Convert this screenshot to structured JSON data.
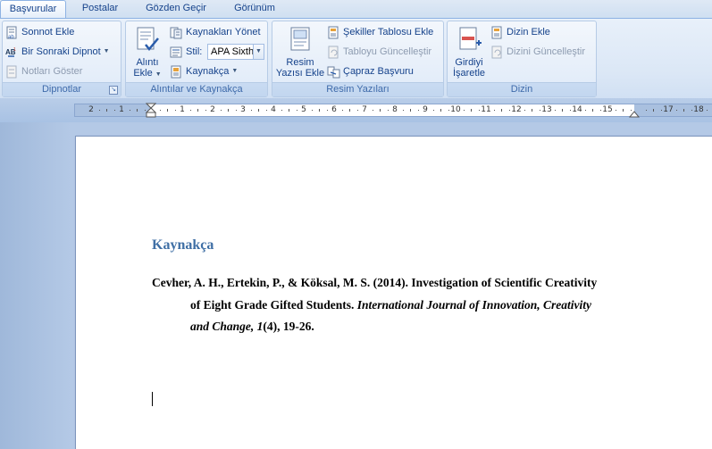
{
  "tabs": [
    {
      "label": "Başvurular",
      "active": true
    },
    {
      "label": "Postalar",
      "active": false
    },
    {
      "label": "Gözden Geçir",
      "active": false
    },
    {
      "label": "Görünüm",
      "active": false
    }
  ],
  "groups": {
    "footnotes": {
      "label": "Dipnotlar",
      "insert_endnote": "Sonnot Ekle",
      "next_footnote": "Bir Sonraki Dipnot",
      "show_notes": "Notları Göster"
    },
    "citations": {
      "label": "Alıntılar ve Kaynakça",
      "insert_citation_line1": "Alıntı",
      "insert_citation_line2": "Ekle",
      "manage_sources": "Kaynakları Yönet",
      "style_label": "Stil:",
      "style_value": "APA Sixth",
      "bibliography": "Kaynakça"
    },
    "captions": {
      "label": "Resim Yazıları",
      "insert_caption_line1": "Resim",
      "insert_caption_line2": "Yazısı Ekle",
      "insert_table_of_figures": "Şekiller Tablosu Ekle",
      "update_table": "Tabloyu Güncelleştir",
      "cross_reference": "Çapraz Başvuru"
    },
    "index": {
      "label": "Dizin",
      "mark_entry_line1": "Girdiyi",
      "mark_entry_line2": "İşaretle",
      "insert_index": "Dizin Ekle",
      "update_index": "Dizini Güncelleştir"
    }
  },
  "ruler": {
    "left_numbers": [
      "2",
      "1"
    ],
    "right_numbers": [
      "1",
      "2",
      "3",
      "4",
      "5",
      "6",
      "7",
      "8",
      "9",
      "10",
      "11",
      "12",
      "13",
      "14",
      "15",
      "17",
      "18"
    ]
  },
  "document": {
    "heading": "Kaynakça",
    "reference": {
      "line1": "Cevher, A. H., Ertekin, P., & Köksal, M. S. (2014). Investigation of Scientific Creativity",
      "line2_plain": "of Eight Grade Gifted Students. ",
      "line2_italic": "International Journal of Innovation, Creativity",
      "line3_italic": "and Change, 1",
      "line3_plain": "(4), 19-26."
    }
  },
  "colors": {
    "accent": "#15428b",
    "heading": "#3f6fa5",
    "ribbon": "#dbe7f6"
  }
}
